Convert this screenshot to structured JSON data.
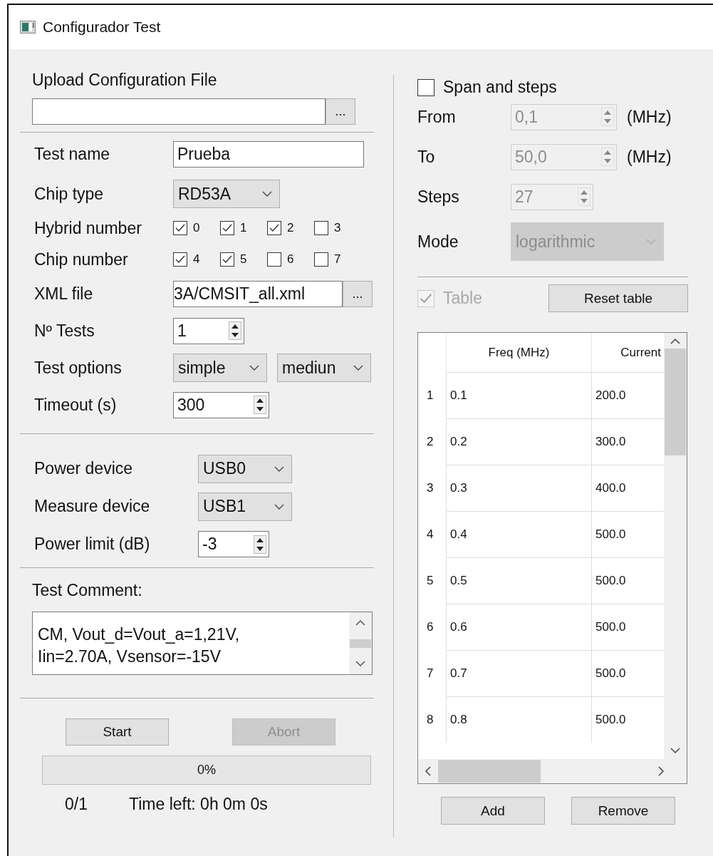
{
  "window": {
    "title": "Configurador Test"
  },
  "upload": {
    "label": "Upload Configuration File",
    "browse": "..."
  },
  "form": [
    {
      "kind": "text",
      "label": "Test name",
      "value": "Prueba"
    },
    {
      "kind": "combo",
      "label": "Chip type",
      "values": [
        "RD53A"
      ]
    },
    {
      "kind": "checks",
      "label": "Hybrid number",
      "options": [
        {
          "label": "0",
          "checked": true
        },
        {
          "label": "1",
          "checked": true
        },
        {
          "label": "2",
          "checked": true
        },
        {
          "label": "3",
          "checked": false
        }
      ]
    },
    {
      "kind": "checks",
      "label": "Chip number",
      "options": [
        {
          "label": "4",
          "checked": true
        },
        {
          "label": "5",
          "checked": true
        },
        {
          "label": "6",
          "checked": false
        },
        {
          "label": "7",
          "checked": false
        }
      ]
    },
    {
      "kind": "file",
      "label": "XML file",
      "value": "3A/CMSIT_all.xml",
      "browse": "..."
    },
    {
      "kind": "spin",
      "label": "Nº Tests",
      "value": "1"
    },
    {
      "kind": "combo",
      "label": "Test options",
      "values": [
        "simple",
        "mediun"
      ]
    },
    {
      "kind": "spin",
      "label": "Timeout (s)",
      "value": "300"
    }
  ],
  "devices": [
    {
      "kind": "combo",
      "label": "Power device",
      "values": [
        "USB0"
      ]
    },
    {
      "kind": "combo",
      "label": "Measure device",
      "values": [
        "USB1"
      ]
    },
    {
      "kind": "spin",
      "label": "Power limit (dB)",
      "value": "-3"
    }
  ],
  "comment": {
    "label": "Test Comment:",
    "lines": [
      "CM, Vout_d=Vout_a=1,21V,",
      "Iin=2.70A, Vsensor=-15V"
    ]
  },
  "actions": [
    {
      "label": "Start",
      "disabled": false
    },
    {
      "label": "Abort",
      "disabled": true
    }
  ],
  "progress": {
    "text": "0%"
  },
  "status": {
    "count": "0/1",
    "time_left": "Time left: 0h 0m 0s"
  },
  "span": {
    "label": "Span and steps",
    "checked": false,
    "fields": [
      {
        "kind": "spin",
        "label": "From",
        "value": "0,1",
        "unit": "(MHz)",
        "disabled": true
      },
      {
        "kind": "spin",
        "label": "To",
        "value": "50,0",
        "unit": "(MHz)",
        "disabled": true
      },
      {
        "kind": "spin",
        "label": "Steps",
        "value": "27",
        "disabled": true
      },
      {
        "kind": "combo",
        "label": "Mode",
        "value": "logarithmic",
        "disabled": true
      }
    ]
  },
  "table_toggle": {
    "label": "Table",
    "checked": true,
    "disabled": true
  },
  "reset_button": "Reset table",
  "table": {
    "columns": [
      "Freq (MHz)",
      "Current"
    ],
    "rows": [
      {
        "index": "1",
        "cells": [
          "0.1",
          "200.0"
        ]
      },
      {
        "index": "2",
        "cells": [
          "0.2",
          "300.0"
        ]
      },
      {
        "index": "3",
        "cells": [
          "0.3",
          "400.0"
        ]
      },
      {
        "index": "4",
        "cells": [
          "0.4",
          "500.0"
        ]
      },
      {
        "index": "5",
        "cells": [
          "0.5",
          "500.0"
        ]
      },
      {
        "index": "6",
        "cells": [
          "0.6",
          "500.0"
        ]
      },
      {
        "index": "7",
        "cells": [
          "0.7",
          "500.0"
        ]
      },
      {
        "index": "8",
        "cells": [
          "0.8",
          "500.0"
        ]
      }
    ]
  },
  "table_buttons": [
    "Add",
    "Remove"
  ]
}
